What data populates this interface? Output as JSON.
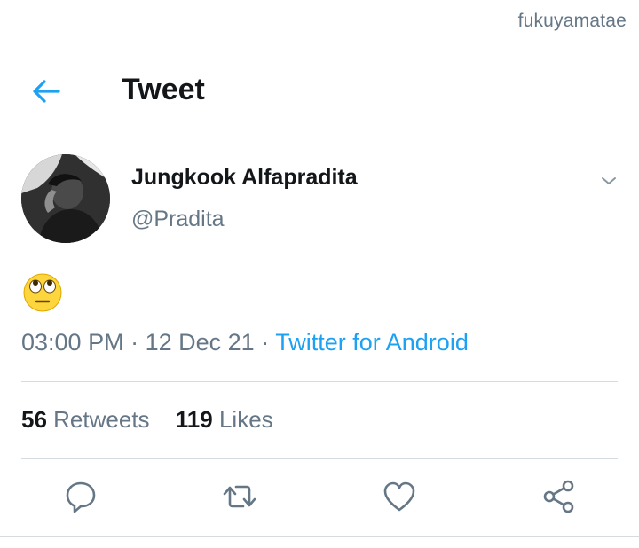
{
  "watermark": "fukuyamatae",
  "header": {
    "title": "Tweet",
    "back_icon": "arrow-left-icon"
  },
  "tweet": {
    "author_name": "Jungkook Alfapradita",
    "author_handle": "@Pradita",
    "text": "🙄",
    "time": "03:00 PM",
    "separator": "·",
    "date": "12 Dec 21",
    "source": "Twitter for Android",
    "retweets_count": "56",
    "retweets_label": "Retweets",
    "likes_count": "119",
    "likes_label": "Likes"
  },
  "actions": [
    "reply-icon",
    "retweet-icon",
    "like-icon",
    "share-icon"
  ],
  "colors": {
    "accent": "#1da1f2",
    "secondary_text": "#657786",
    "primary_text": "#14171a",
    "divider": "#d6dbe0"
  }
}
